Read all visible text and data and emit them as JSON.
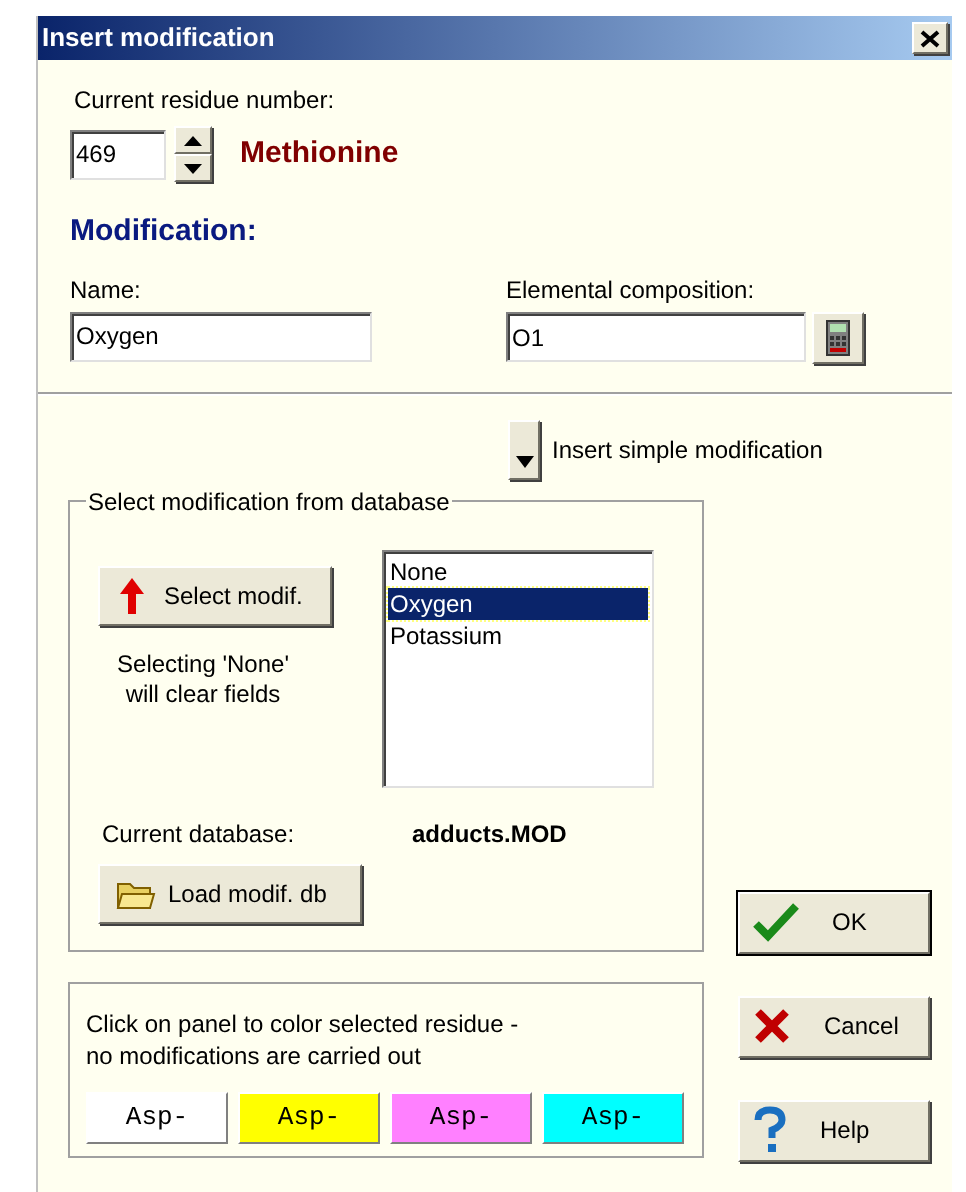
{
  "window": {
    "title": "Insert modification"
  },
  "residue": {
    "label": "Current residue number:",
    "value": "469",
    "name": "Methionine"
  },
  "modification": {
    "heading": "Modification:",
    "name_label": "Name:",
    "name_value": "Oxygen",
    "composition_label": "Elemental composition:",
    "composition_value": "O1"
  },
  "simple_button": {
    "label": "Insert simple modification"
  },
  "database_group": {
    "title": "Select modification from database",
    "select_button": "Select modif.",
    "hint_lines": [
      "Selecting 'None'",
      "will clear fields"
    ],
    "list": [
      {
        "label": "None",
        "selected": false
      },
      {
        "label": "Oxygen",
        "selected": true
      },
      {
        "label": "Potassium",
        "selected": false
      }
    ],
    "current_label": "Current database:",
    "current_value": "adducts.MOD",
    "load_button": "Load modif. db"
  },
  "color_group": {
    "lines": [
      "Click on panel to color selected residue -",
      "no modifications are carried out"
    ],
    "swatches": [
      {
        "label": "Asp-",
        "color": "#ffffff"
      },
      {
        "label": "Asp-",
        "color": "#ffff00"
      },
      {
        "label": "Asp-",
        "color": "#ff80ff"
      },
      {
        "label": "Asp-",
        "color": "#00ffff"
      }
    ]
  },
  "buttons": [
    {
      "kind": "ok",
      "label": "OK",
      "default": true
    },
    {
      "kind": "cancel",
      "label": "Cancel",
      "default": false
    },
    {
      "kind": "help",
      "label": "Help",
      "default": false
    }
  ]
}
